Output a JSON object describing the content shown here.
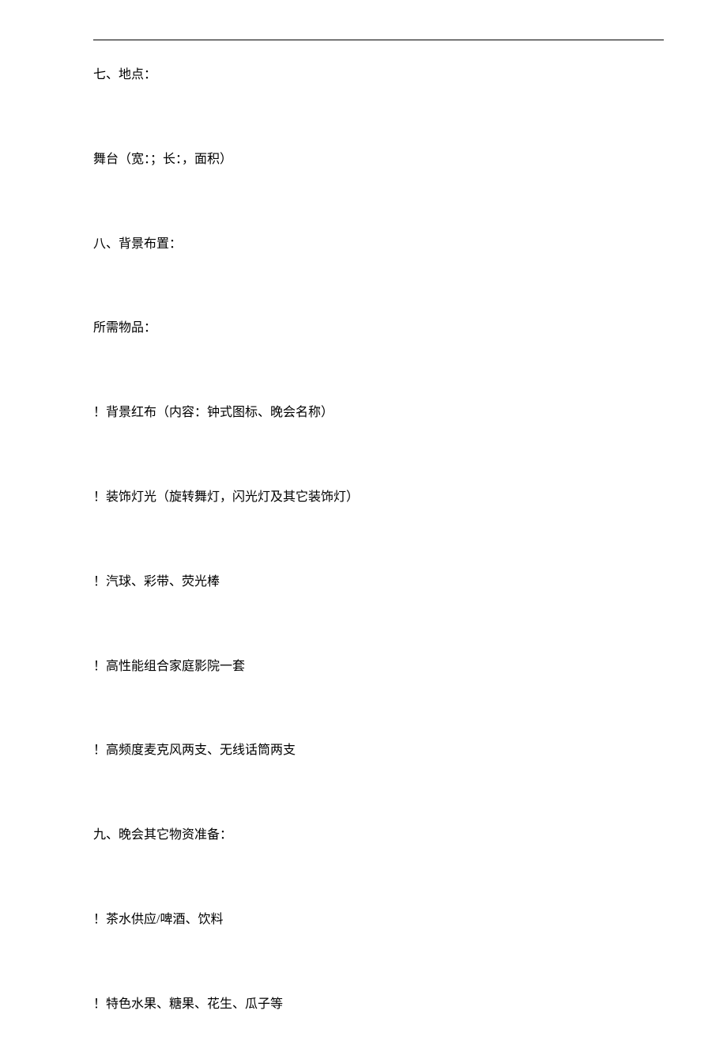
{
  "lines": [
    "七、地点：",
    "舞台（宽：；长：，面积）",
    "八、背景布置：",
    "所需物品：",
    "！背景红布（内容：钟式图标、晚会名称）",
    "！装饰灯光（旋转舞灯，闪光灯及其它装饰灯）",
    "！汽球、彩带、荧光棒",
    "！高性能组合家庭影院一套",
    "！高频度麦克风两支、无线话筒两支",
    "九、晚会其它物资准备：",
    "！茶水供应/啤酒、饮料",
    "！特色水果、糖果、花生、瓜子等"
  ]
}
